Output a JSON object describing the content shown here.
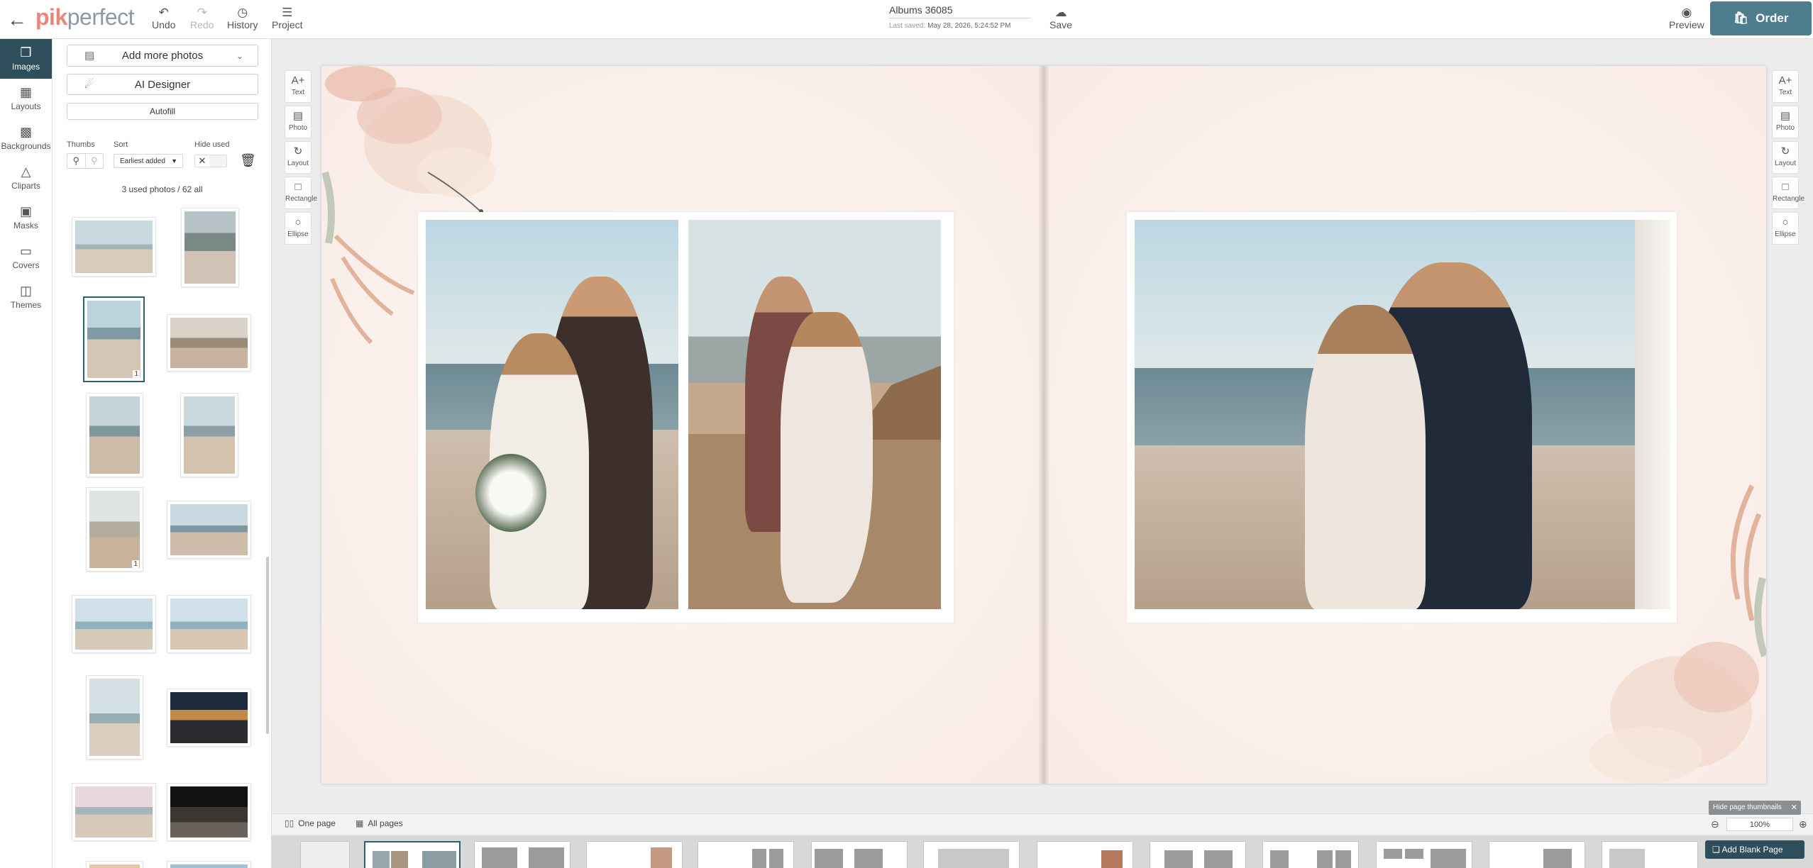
{
  "header": {
    "logo_pik": "pik",
    "logo_perfect": "perfect",
    "undo": "Undo",
    "redo": "Redo",
    "history": "History",
    "project": "Project",
    "doc_title": "Albums 36085",
    "last_saved_label": "Last saved:",
    "last_saved_value": "May 28, 2026, 5:24:52 PM",
    "save": "Save",
    "preview": "Preview",
    "order": "Order"
  },
  "sidebar": {
    "items": [
      {
        "label": "Images",
        "icon": "images-icon"
      },
      {
        "label": "Layouts",
        "icon": "layouts-icon"
      },
      {
        "label": "Backgrounds",
        "icon": "backgrounds-icon"
      },
      {
        "label": "Cliparts",
        "icon": "cliparts-icon"
      },
      {
        "label": "Masks",
        "icon": "masks-icon"
      },
      {
        "label": "Covers",
        "icon": "covers-icon"
      },
      {
        "label": "Themes",
        "icon": "themes-icon"
      }
    ]
  },
  "panel": {
    "add_photos": "Add more photos",
    "ai_designer": "AI Designer",
    "autofill": "Autofill",
    "thumbs_label": "Thumbs",
    "sort_label": "Sort",
    "sort_value": "Earliest added",
    "hide_used_label": "Hide used",
    "count": "3 used photos / 62 all",
    "thumb_badges": [
      "1",
      "1"
    ]
  },
  "tools": {
    "left": [
      "Text",
      "Photo",
      "Layout",
      "Rectangle",
      "Ellipse"
    ],
    "right": [
      "Text",
      "Photo",
      "Layout",
      "Rectangle",
      "Ellipse"
    ]
  },
  "bottom": {
    "one_page": "One page",
    "all_pages": "All pages",
    "hide_thumbnails": "Hide page thumbnails",
    "zoom": "100%",
    "add_blank_page": "Add Blank Page"
  },
  "colors": {
    "accent": "#2f4e5c",
    "order_button": "#4e7d8f",
    "logo_pink": "#e7877a",
    "logo_grey": "#8c99a6",
    "page_background": "#fbf2ee"
  }
}
